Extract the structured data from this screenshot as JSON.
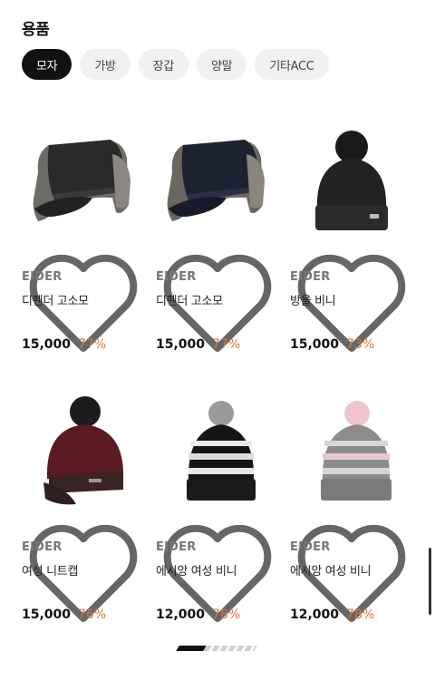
{
  "section": {
    "title": "용품"
  },
  "categories": [
    {
      "label": "모자",
      "active": true
    },
    {
      "label": "가방",
      "active": false
    },
    {
      "label": "장갑",
      "active": false
    },
    {
      "label": "양말",
      "active": false
    },
    {
      "label": "기타ACC",
      "active": false
    }
  ],
  "products": [
    {
      "brand": "EIDER",
      "name": "디펜더 고소모",
      "price": "15,000",
      "discount": "77%",
      "image": "black-trapper-hat-icon"
    },
    {
      "brand": "EIDER",
      "name": "디펜더 고소모",
      "price": "15,000",
      "discount": "77%",
      "image": "navy-trapper-hat-icon"
    },
    {
      "brand": "EIDER",
      "name": "방울 비니",
      "price": "15,000",
      "discount": "73%",
      "image": "black-pompom-beanie-icon"
    },
    {
      "brand": "EIDER",
      "name": "여성 니트캡",
      "price": "15,000",
      "discount": "76%",
      "image": "burgundy-knit-cap-icon"
    },
    {
      "brand": "EIDER",
      "name": "에시앙 여성 비니",
      "price": "12,000",
      "discount": "78%",
      "image": "black-white-pattern-beanie-icon"
    },
    {
      "brand": "EIDER",
      "name": "에시앙 여성 비니",
      "price": "12,000",
      "discount": "78%",
      "image": "grey-pink-pattern-beanie-icon"
    }
  ],
  "colors": {
    "discount": "#d8763f",
    "active_chip": "#111111",
    "chip_bg": "#f1f1f1"
  }
}
